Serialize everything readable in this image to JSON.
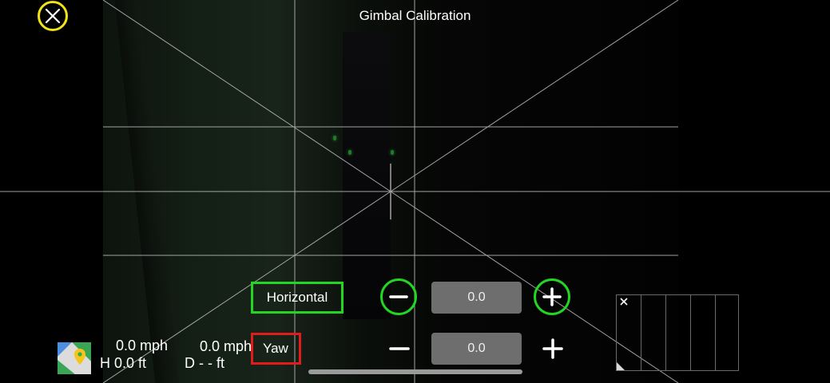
{
  "header": {
    "title": "Gimbal Calibration"
  },
  "calibration": {
    "mode_label": "Horizontal",
    "axis_label": "Yaw",
    "horizontal_value": "0.0",
    "yaw_value": "0.0"
  },
  "telemetry": {
    "horizontal_speed": "0.0 mph",
    "vertical_speed": "0.0 mph",
    "height": "H 0.0 ft",
    "distance": "D - - ft"
  },
  "icons": {
    "close": "close-icon",
    "minus": "minus-icon",
    "plus": "plus-icon",
    "map": "map-icon"
  },
  "colors": {
    "highlight_green": "#22d622",
    "highlight_red": "#e21b1b",
    "highlight_yellow": "#f2e21a",
    "value_box": "#6e6e6e"
  }
}
